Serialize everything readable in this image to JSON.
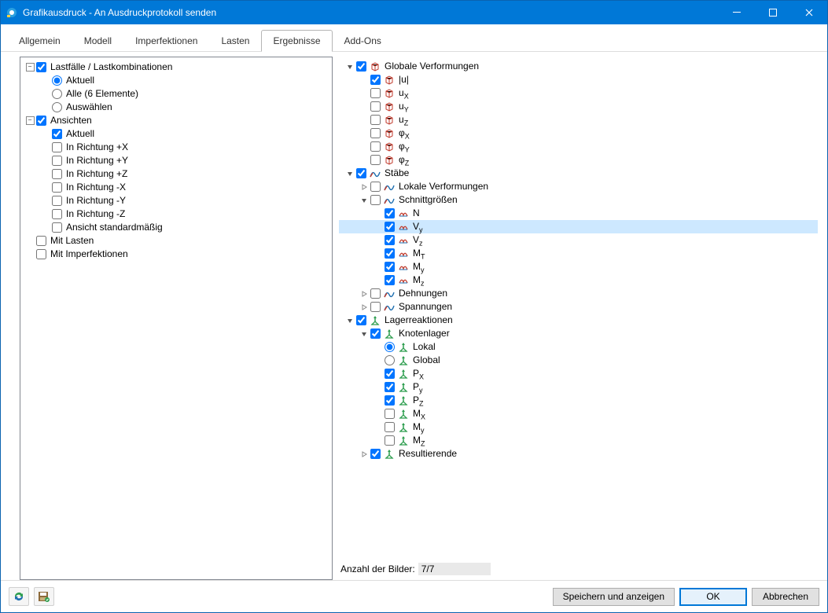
{
  "window": {
    "title": "Grafikausdruck - An Ausdruckprotokoll senden"
  },
  "tabs": [
    {
      "label": "Allgemein",
      "active": false
    },
    {
      "label": "Modell",
      "active": false
    },
    {
      "label": "Imperfektionen",
      "active": false
    },
    {
      "label": "Lasten",
      "active": false
    },
    {
      "label": "Ergebnisse",
      "active": true
    },
    {
      "label": "Add-Ons",
      "active": false
    }
  ],
  "left_tree": [
    {
      "depth": 0,
      "expander": "minus",
      "chk": true,
      "label": "Lastfälle / Lastkombinationen",
      "name": "node-load-cases"
    },
    {
      "depth": 1,
      "radio": true,
      "label": "Aktuell",
      "name": "opt-aktuell"
    },
    {
      "depth": 1,
      "radio": false,
      "label": "Alle (6 Elemente)",
      "name": "opt-alle"
    },
    {
      "depth": 1,
      "radio": false,
      "label": "Auswählen",
      "name": "opt-auswaehlen"
    },
    {
      "depth": 0,
      "expander": "minus",
      "chk": true,
      "label": "Ansichten",
      "name": "node-ansichten"
    },
    {
      "depth": 1,
      "chk": true,
      "label": "Aktuell",
      "name": "view-aktuell"
    },
    {
      "depth": 1,
      "chk": false,
      "label": "In Richtung +X",
      "name": "view-plus-x"
    },
    {
      "depth": 1,
      "chk": false,
      "label": "In Richtung +Y",
      "name": "view-plus-y"
    },
    {
      "depth": 1,
      "chk": false,
      "label": "In Richtung +Z",
      "name": "view-plus-z"
    },
    {
      "depth": 1,
      "chk": false,
      "label": "In Richtung -X",
      "name": "view-minus-x"
    },
    {
      "depth": 1,
      "chk": false,
      "label": "In Richtung -Y",
      "name": "view-minus-y"
    },
    {
      "depth": 1,
      "chk": false,
      "label": "In Richtung -Z",
      "name": "view-minus-z"
    },
    {
      "depth": 1,
      "chk": false,
      "label": "Ansicht standardmäßig",
      "name": "view-default"
    },
    {
      "depth": 0,
      "chk": false,
      "label": "Mit Lasten",
      "name": "with-loads"
    },
    {
      "depth": 0,
      "chk": false,
      "label": "Mit Imperfektionen",
      "name": "with-imperfections"
    }
  ],
  "right_tree": [
    {
      "depth": 0,
      "expander": "open",
      "chk": true,
      "icon": "cube",
      "label": "Globale Verformungen",
      "name": "node-global-deform"
    },
    {
      "depth": 1,
      "chk": true,
      "icon": "cube",
      "label": "|u|",
      "name": "gv-u"
    },
    {
      "depth": 1,
      "chk": false,
      "icon": "cube",
      "label": "u",
      "sub": "X",
      "name": "gv-ux"
    },
    {
      "depth": 1,
      "chk": false,
      "icon": "cube",
      "label": "u",
      "sub": "Y",
      "name": "gv-uy"
    },
    {
      "depth": 1,
      "chk": false,
      "icon": "cube",
      "label": "u",
      "sub": "Z",
      "name": "gv-uz"
    },
    {
      "depth": 1,
      "chk": false,
      "icon": "cube",
      "label": "φ",
      "sub": "X",
      "name": "gv-phix"
    },
    {
      "depth": 1,
      "chk": false,
      "icon": "cube",
      "label": "φ",
      "sub": "Y",
      "name": "gv-phiy"
    },
    {
      "depth": 1,
      "chk": false,
      "icon": "cube",
      "label": "φ",
      "sub": "Z",
      "name": "gv-phiz"
    },
    {
      "depth": 0,
      "expander": "open",
      "chk": true,
      "icon": "diag",
      "label": "Stäbe",
      "name": "node-staebe"
    },
    {
      "depth": 1,
      "expander": "closed",
      "chk": false,
      "icon": "diag",
      "label": "Lokale Verformungen",
      "name": "st-lokal"
    },
    {
      "depth": 1,
      "expander": "open",
      "chk": false,
      "icon": "diag",
      "label": "Schnittgrößen",
      "name": "st-schnitt"
    },
    {
      "depth": 2,
      "chk": true,
      "icon": "force",
      "label": "N",
      "name": "sg-n"
    },
    {
      "depth": 2,
      "chk": true,
      "icon": "force",
      "label": "V",
      "sub": "y",
      "name": "sg-vy",
      "selected": true
    },
    {
      "depth": 2,
      "chk": true,
      "icon": "force",
      "label": "V",
      "sub": "z",
      "name": "sg-vz"
    },
    {
      "depth": 2,
      "chk": true,
      "icon": "force",
      "label": "M",
      "sub": "T",
      "name": "sg-mt"
    },
    {
      "depth": 2,
      "chk": true,
      "icon": "force",
      "label": "M",
      "sub": "y",
      "name": "sg-my"
    },
    {
      "depth": 2,
      "chk": true,
      "icon": "force",
      "label": "M",
      "sub": "z",
      "name": "sg-mz"
    },
    {
      "depth": 1,
      "expander": "closed",
      "chk": false,
      "icon": "diag",
      "label": "Dehnungen",
      "name": "st-dehn"
    },
    {
      "depth": 1,
      "expander": "closed",
      "chk": false,
      "icon": "diag",
      "label": "Spannungen",
      "name": "st-spann"
    },
    {
      "depth": 0,
      "expander": "open",
      "chk": true,
      "icon": "support",
      "label": "Lagerreaktionen",
      "name": "node-lager"
    },
    {
      "depth": 1,
      "expander": "open",
      "chk": true,
      "icon": "support",
      "label": "Knotenlager",
      "name": "lg-knoten"
    },
    {
      "depth": 2,
      "radio": true,
      "icon": "support",
      "label": "Lokal",
      "name": "lg-lokal"
    },
    {
      "depth": 2,
      "radio": false,
      "icon": "support",
      "label": "Global",
      "name": "lg-global"
    },
    {
      "depth": 2,
      "chk": true,
      "icon": "support",
      "label": "P",
      "sub": "X",
      "name": "lg-px"
    },
    {
      "depth": 2,
      "chk": true,
      "icon": "support",
      "label": "P",
      "sub": "y",
      "name": "lg-py"
    },
    {
      "depth": 2,
      "chk": true,
      "icon": "support",
      "label": "P",
      "sub": "Z",
      "name": "lg-pz"
    },
    {
      "depth": 2,
      "chk": false,
      "icon": "support",
      "label": "M",
      "sub": "X",
      "name": "lg-mx"
    },
    {
      "depth": 2,
      "chk": false,
      "icon": "support",
      "label": "M",
      "sub": "y",
      "name": "lg-my"
    },
    {
      "depth": 2,
      "chk": false,
      "icon": "support",
      "label": "M",
      "sub": "Z",
      "name": "lg-mz"
    },
    {
      "depth": 1,
      "expander": "closed",
      "chk": true,
      "icon": "support",
      "label": "Resultierende",
      "name": "lg-result"
    }
  ],
  "count": {
    "label": "Anzahl der Bilder:",
    "value": "7/7"
  },
  "buttons": {
    "save_show": "Speichern und anzeigen",
    "ok": "OK",
    "cancel": "Abbrechen"
  }
}
